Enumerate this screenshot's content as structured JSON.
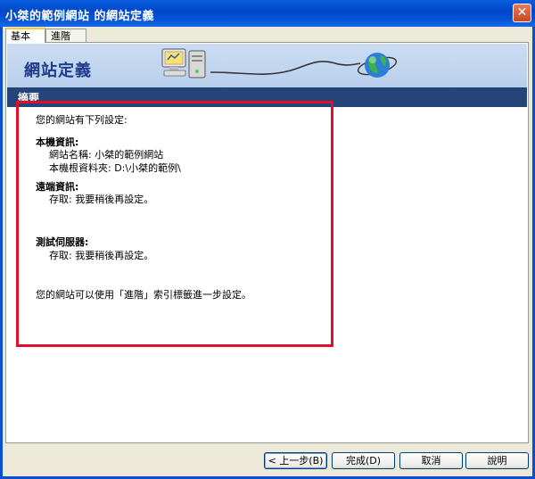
{
  "window": {
    "title": "小桀的範例網站 的網站定義",
    "close_glyph": "✕"
  },
  "tabs": [
    {
      "label": "基本"
    },
    {
      "label": "進階"
    }
  ],
  "banner": {
    "title": "網站定義"
  },
  "section": {
    "label": "摘要"
  },
  "summary": {
    "intro": "您的網站有下列設定:",
    "local_heading": "本機資訊:",
    "site_name": "網站名稱: 小桀的範例網站",
    "root_folder": "本機根資料夾: D:\\小桀的範例\\",
    "remote_heading": "遠端資訊:",
    "remote_access": "存取: 我要稍後再設定。",
    "test_heading": "測試伺服器:",
    "test_access": "存取: 我要稍後再設定。",
    "advanced_note": "您的網站可以使用「進階」索引標籤進一步設定。"
  },
  "buttons": {
    "back": "< 上一步(B)",
    "finish": "完成(D)",
    "cancel": "取消",
    "help": "說明"
  },
  "colors": {
    "highlight": "#E0102A",
    "section_bar": "#25457A",
    "banner": "#C4D7F0"
  }
}
